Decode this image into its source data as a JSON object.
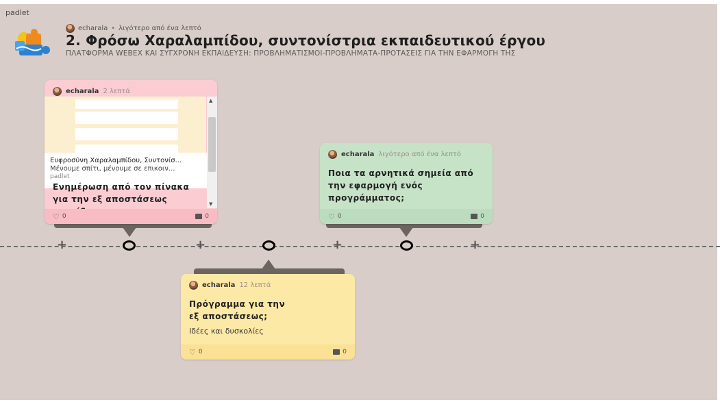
{
  "brand": "padlet",
  "header": {
    "author": "echarala",
    "time": "λιγότερο από ένα λεπτό",
    "title": "2. Φρόσω Χαραλαμπίδου, συντονίστρια εκπαιδευτικού έργου",
    "subtitle": "ΠΛΑΤΦΟΡΜΑ WEBEX ΚΑΙ ΣΥΓΧΡΟΝΗ ΕΚΠΑΙΔΕΥΣΗ: ΠΡΟΒΛΗΜΑΤΙΣΜΟΙ-ΠΡΟΒΛΗΜΑΤΑ-ΠΡΟΤΑΣΕΙΣ ΓΙΑ ΤΗΝ ΕΦΑΡΜΟΓΗ ΤΗΣ"
  },
  "cards": [
    {
      "author": "echarala",
      "time": "2 λεπτά",
      "color": "#fbcdd3",
      "embed": {
        "title": "Ευφροσύνη Χαραλαμπίδου, Συντονίσ...",
        "desc": "Μένουμε σπίτι, μένουμε σε επικοιν...",
        "source": "padlet"
      },
      "title": "Ενημέρωση από τον πίνακα για την εξ αποστάσεως εκπαίδευση",
      "likes": "0",
      "comments": "0"
    },
    {
      "author": "echarala",
      "time": "λιγότερο από ένα λεπτό",
      "color": "#c6e3c8",
      "title": "Ποια τα αρνητικά σημεία από την εφαρμογή ενός προγράμματος;",
      "likes": "0",
      "comments": "0"
    },
    {
      "author": "echarala",
      "time": "12 λεπτά",
      "color": "#fde9a6",
      "title": "Πρόγραμμα για την εξ αποστάσεως;",
      "body": "Ιδέες και δυσκολίες",
      "likes": "0",
      "comments": "0"
    }
  ]
}
